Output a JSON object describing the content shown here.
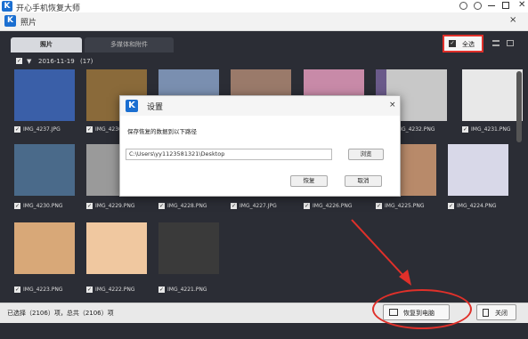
{
  "app": {
    "logo_letter": "K",
    "title": "开心手机恢复大师"
  },
  "photo_window": {
    "logo_letter": "K",
    "title": "照片",
    "close": "×"
  },
  "tabs": [
    {
      "label": "照片",
      "active": true
    },
    {
      "label": "多媒体和附件",
      "active": false
    }
  ],
  "toolbar": {
    "select_all_label": "全选",
    "select_all_checked": true
  },
  "group": {
    "date": "2016-11-19",
    "count": "(17)"
  },
  "photos": [
    {
      "name": "IMG_4237.JPG",
      "color": "#3a5fa8"
    },
    {
      "name": "IMG_4236.JPG",
      "color": "#8a6a3a"
    },
    {
      "name": "",
      "color": "#7a8fb0"
    },
    {
      "name": "",
      "color": "#9a7a6a"
    },
    {
      "name": "",
      "color": "#c88aa8"
    },
    {
      "name": "",
      "color": "#6a5a8a"
    },
    {
      "name": "IMG_4232.PNG",
      "color": "#c8c8c8"
    },
    {
      "name": "IMG_4231.PNG",
      "color": "#e8e8e8"
    },
    {
      "name": "IMG_4230.PNG",
      "color": "#4a6a8a"
    },
    {
      "name": "IMG_4229.PNG",
      "color": "#9a9a9a"
    },
    {
      "name": "IMG_4228.PNG",
      "color": "#5a5a6a"
    },
    {
      "name": "IMG_4227.JPG",
      "color": "#6a6a7a"
    },
    {
      "name": "IMG_4226.PNG",
      "color": "#8a7a6a"
    },
    {
      "name": "IMG_4225.PNG",
      "color": "#b88a6a"
    },
    {
      "name": "IMG_4224.PNG",
      "color": "#d8d8e8"
    },
    {
      "name": "IMG_4223.PNG",
      "color": "#d8a878"
    },
    {
      "name": "IMG_4222.PNG",
      "color": "#f0c8a0"
    },
    {
      "name": "IMG_4221.PNG",
      "color": "#3a3a3a"
    }
  ],
  "dialog": {
    "logo_letter": "K",
    "title": "设置",
    "close": "×",
    "prompt": "保存恢复的数据到以下路径",
    "path": "C:\\Users\\yy1123581321\\Desktop",
    "browse_label": "浏览",
    "restore_label": "恢复",
    "cancel_label": "取消"
  },
  "status": {
    "text": "已选择（2106）项，总共（2106）项",
    "restore_to_pc_label": "恢复到电脑",
    "close_label": "关闭"
  },
  "colors": {
    "panel": "#2b2d35",
    "accent_blue": "#1b6fd1",
    "annotation_red": "#e0302a"
  }
}
